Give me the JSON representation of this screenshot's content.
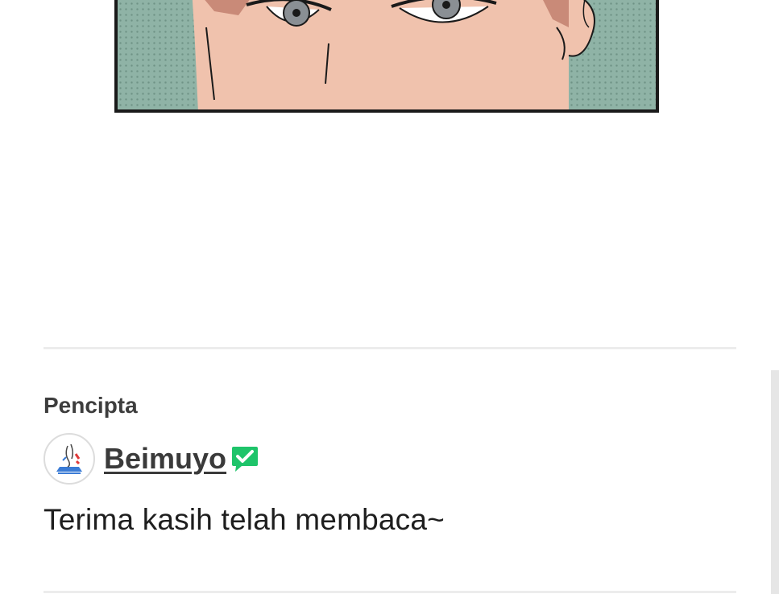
{
  "creator_section": {
    "heading": "Pencipta",
    "creator_name": "Beimuyo",
    "verified_icon": "verified-badge-icon",
    "avatar_icon": "creator-avatar"
  },
  "author_note": "Terima kasih telah membaca~",
  "colors": {
    "panel_background": "#8fb3a6",
    "skin": "#f0c2ad",
    "verified": "#1ec46a",
    "text_dark": "#3a3a3a"
  }
}
